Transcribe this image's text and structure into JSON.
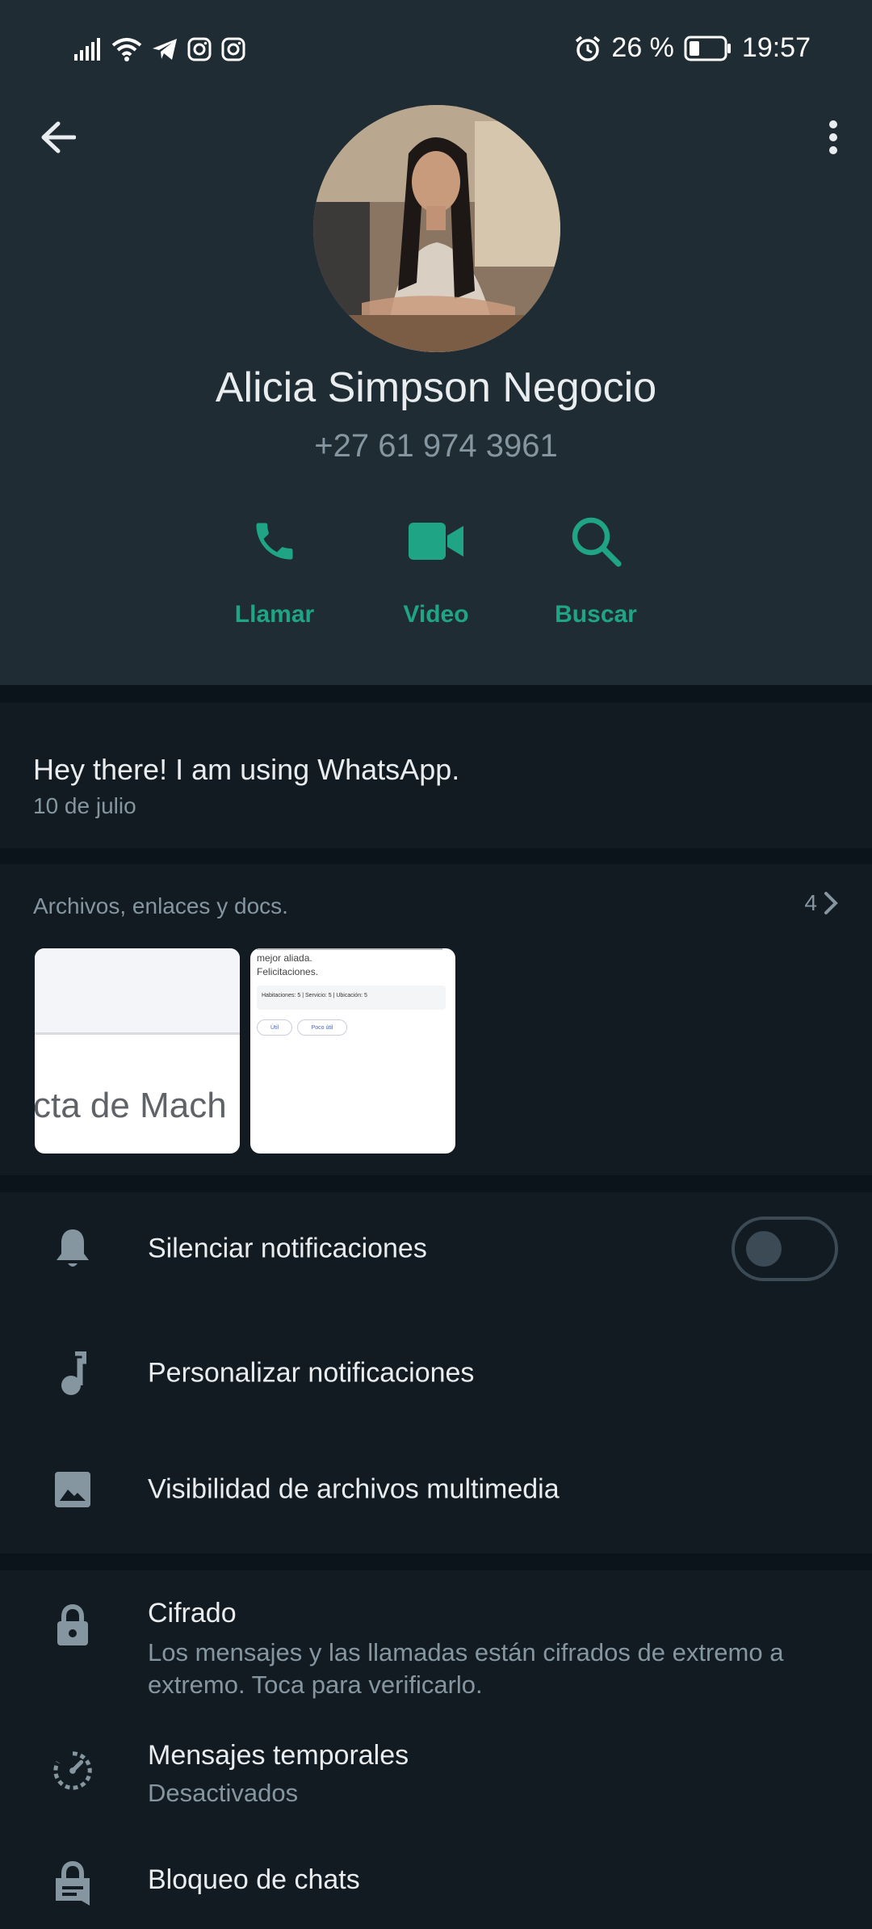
{
  "status_bar": {
    "battery_percent": "26 %",
    "time": "19:57",
    "icons": [
      "signal-icon",
      "wifi-icon",
      "telegram-icon",
      "instagram-icon",
      "instagram-icon",
      "alarm-icon",
      "battery-icon"
    ]
  },
  "header": {
    "back_icon": "arrow-left-icon",
    "menu_icon": "more-vertical-icon",
    "contact_name": "Alicia Simpson Negocio",
    "phone": "+27 61 974 3961",
    "actions": [
      {
        "label": "Llamar",
        "icon": "phone-icon"
      },
      {
        "label": "Video",
        "icon": "videocam-icon"
      },
      {
        "label": "Buscar",
        "icon": "search-icon"
      }
    ],
    "accent_color": "#1fa585"
  },
  "about": {
    "text": "Hey there! I am using WhatsApp.",
    "date": "10 de julio"
  },
  "media": {
    "heading": "Archivos, enlaces y docs.",
    "count": "4",
    "thumb1_text": "cta de Mach",
    "thumb2_lines": [
      "mejor aliada.",
      "Felicitaciones."
    ],
    "thumb2_ratings": "Habitaciones: 5 | Servicio: 5 | Ubicación: 5",
    "thumb2_buttons": [
      "Útil",
      "Poco útil"
    ]
  },
  "settings": {
    "mute": {
      "label": "Silenciar notificaciones",
      "icon": "bell-icon",
      "enabled": false
    },
    "custom": {
      "label": "Personalizar notificaciones",
      "icon": "music-note-icon"
    },
    "media_visibility": {
      "label": "Visibilidad de archivos multimedia",
      "icon": "image-icon"
    }
  },
  "security": {
    "encryption": {
      "title": "Cifrado",
      "subtitle": "Los mensajes y las llamadas están cifrados de extremo a extremo. Toca para verificarlo.",
      "icon": "lock-icon"
    },
    "disappearing": {
      "title": "Mensajes temporales",
      "subtitle": "Desactivados",
      "icon": "timer-icon"
    },
    "chat_lock": {
      "title": "Bloqueo de chats",
      "icon": "chat-lock-icon"
    }
  }
}
